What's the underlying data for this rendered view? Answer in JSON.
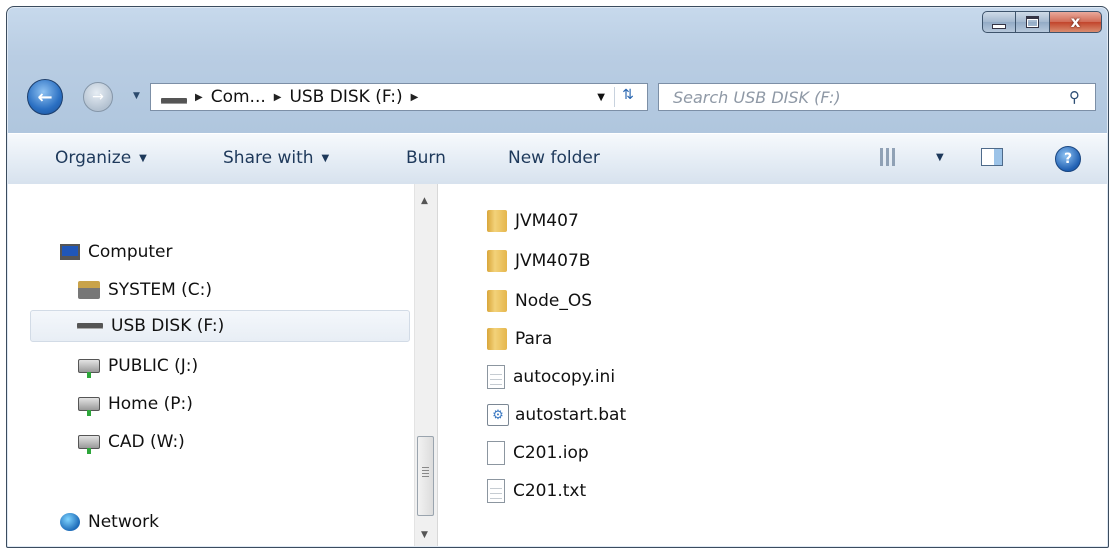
{
  "window": {
    "caption": {
      "minimize": "minimize",
      "maximize": "maximize",
      "close": "x"
    }
  },
  "nav": {
    "breadcrumb": [
      "Com...",
      "USB DISK (F:)"
    ],
    "search_placeholder": "Search USB DISK (F:)"
  },
  "toolbar": {
    "organize": "Organize",
    "share_with": "Share with",
    "burn": "Burn",
    "new_folder": "New folder",
    "help": "?"
  },
  "sidebar": {
    "items": [
      {
        "label": "Computer",
        "icon": "computer-icon"
      },
      {
        "label": "SYSTEM (C:)",
        "icon": "system-drive-icon"
      },
      {
        "label": "USB DISK (F:)",
        "icon": "usb-drive-icon",
        "selected": true
      },
      {
        "label": "PUBLIC (J:)",
        "icon": "network-drive-icon"
      },
      {
        "label": "Home (P:)",
        "icon": "network-drive-icon"
      },
      {
        "label": "CAD (W:)",
        "icon": "network-drive-icon"
      },
      {
        "label": "Network",
        "icon": "network-icon"
      }
    ]
  },
  "files": [
    {
      "name": "JVM407",
      "type": "folder"
    },
    {
      "name": "JVM407B",
      "type": "folder"
    },
    {
      "name": "Node_OS",
      "type": "folder"
    },
    {
      "name": "Para",
      "type": "folder"
    },
    {
      "name": "autocopy.ini",
      "type": "text"
    },
    {
      "name": "autostart.bat",
      "type": "batch"
    },
    {
      "name": "C201.iop",
      "type": "blank"
    },
    {
      "name": "C201.txt",
      "type": "text"
    }
  ]
}
